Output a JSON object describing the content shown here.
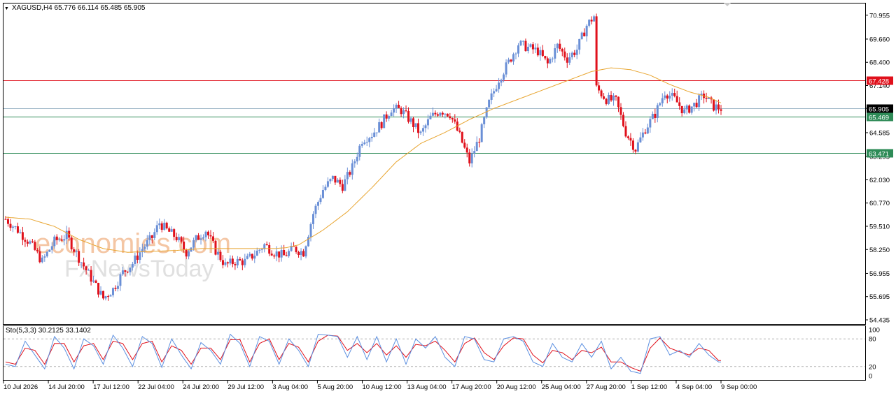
{
  "header": {
    "symbol": "XAGUSD,H4",
    "open": "65.776",
    "high": "66.114",
    "low": "65.485",
    "close": "65.905"
  },
  "watermark": {
    "line1": "economies.com",
    "line2": "FxNewsToday"
  },
  "stochastic": {
    "label": "Sto(5,3,3)",
    "main_value": "30.2125",
    "signal_value": "33.1402",
    "axis_labels": [
      "100",
      "80",
      "20",
      "0"
    ]
  },
  "colors": {
    "bull": "#6A8FD6",
    "bear": "#E0101B",
    "ma": "#E8A530",
    "resistance": "#E0101B",
    "support": "#2E8B57",
    "current": "#9FB8C8",
    "sto_main": "#5B8FE0",
    "sto_signal": "#E0101B"
  },
  "chart_data": {
    "type": "candlestick",
    "title": "",
    "y_ticks": [
      "70.955",
      "69.660",
      "68.400",
      "67.140",
      "65.905",
      "64.585",
      "63.295",
      "62.030",
      "60.770",
      "59.510",
      "58.250",
      "56.955",
      "55.695",
      "54.435"
    ],
    "ylim": [
      54.435,
      71.4
    ],
    "x_tick_labels": [
      "10 Jul 2026",
      "14 Jul 20:00",
      "17 Jul 12:00",
      "22 Jul 04:00",
      "24 Jul 20:00",
      "29 Jul 12:00",
      "3 Aug 04:00",
      "5 Aug 20:00",
      "10 Aug 12:00",
      "13 Aug 04:00",
      "17 Aug 20:00",
      "20 Aug 12:00",
      "25 Aug 04:00",
      "27 Aug 20:00",
      "1 Sep 12:00",
      "4 Sep 04:00",
      "9 Sep 00:00"
    ],
    "horizontal_levels": [
      {
        "value": 67.428,
        "label": "67.428",
        "kind": "resistance"
      },
      {
        "value": 65.905,
        "label": "65.905",
        "kind": "current"
      },
      {
        "value": 65.469,
        "label": "65.469",
        "kind": "support"
      },
      {
        "value": 63.471,
        "label": "63.471",
        "kind": "support"
      }
    ],
    "close_path": [
      [
        0,
        59.9
      ],
      [
        5,
        59.3
      ],
      [
        10,
        58.6
      ],
      [
        15,
        57.6
      ],
      [
        20,
        58.7
      ],
      [
        25,
        59.0
      ],
      [
        30,
        57.8
      ],
      [
        35,
        56.7
      ],
      [
        40,
        55.6
      ],
      [
        44,
        56.1
      ],
      [
        48,
        57.0
      ],
      [
        52,
        57.5
      ],
      [
        56,
        58.3
      ],
      [
        60,
        58.9
      ],
      [
        63,
        59.7
      ],
      [
        66,
        59.3
      ],
      [
        70,
        58.9
      ],
      [
        74,
        58.1
      ],
      [
        78,
        58.8
      ],
      [
        82,
        59.3
      ],
      [
        86,
        58.2
      ],
      [
        90,
        57.4
      ],
      [
        94,
        57.6
      ],
      [
        98,
        57.6
      ],
      [
        102,
        58.0
      ],
      [
        106,
        58.5
      ],
      [
        110,
        58.1
      ],
      [
        114,
        57.9
      ],
      [
        118,
        58.3
      ],
      [
        122,
        58.1
      ],
      [
        126,
        60.2
      ],
      [
        130,
        61.5
      ],
      [
        134,
        62.1
      ],
      [
        138,
        61.7
      ],
      [
        142,
        62.7
      ],
      [
        146,
        64.2
      ],
      [
        150,
        64.5
      ],
      [
        154,
        65.1
      ],
      [
        158,
        65.9
      ],
      [
        162,
        65.8
      ],
      [
        166,
        65.2
      ],
      [
        170,
        64.5
      ],
      [
        174,
        65.4
      ],
      [
        178,
        65.8
      ],
      [
        182,
        65.6
      ],
      [
        186,
        64.4
      ],
      [
        190,
        63.0
      ],
      [
        194,
        64.3
      ],
      [
        198,
        66.2
      ],
      [
        202,
        67.5
      ],
      [
        206,
        68.4
      ],
      [
        210,
        69.4
      ],
      [
        214,
        69.2
      ],
      [
        218,
        69.0
      ],
      [
        222,
        68.3
      ],
      [
        226,
        69.3
      ],
      [
        230,
        68.6
      ],
      [
        234,
        69.1
      ],
      [
        238,
        70.4
      ],
      [
        241,
        70.9
      ],
      [
        242,
        67.0
      ],
      [
        246,
        66.4
      ],
      [
        250,
        66.3
      ],
      [
        254,
        64.6
      ],
      [
        258,
        63.7
      ],
      [
        262,
        64.8
      ],
      [
        266,
        65.6
      ],
      [
        270,
        66.8
      ],
      [
        274,
        66.4
      ],
      [
        278,
        65.7
      ],
      [
        282,
        66.1
      ],
      [
        286,
        66.6
      ],
      [
        290,
        66.0
      ],
      [
        293,
        65.9
      ]
    ],
    "ma_path": [
      [
        0,
        60.0
      ],
      [
        10,
        59.9
      ],
      [
        20,
        59.5
      ],
      [
        30,
        58.8
      ],
      [
        40,
        58.3
      ],
      [
        50,
        58.1
      ],
      [
        60,
        58.15
      ],
      [
        70,
        58.2
      ],
      [
        80,
        58.3
      ],
      [
        90,
        58.3
      ],
      [
        100,
        58.3
      ],
      [
        110,
        58.3
      ],
      [
        115,
        58.35
      ],
      [
        120,
        58.5
      ],
      [
        130,
        59.3
      ],
      [
        140,
        60.3
      ],
      [
        150,
        61.6
      ],
      [
        160,
        63.0
      ],
      [
        170,
        64.0
      ],
      [
        180,
        64.6
      ],
      [
        190,
        65.3
      ],
      [
        200,
        65.9
      ],
      [
        210,
        66.4
      ],
      [
        220,
        66.9
      ],
      [
        230,
        67.4
      ],
      [
        240,
        67.9
      ],
      [
        248,
        68.1
      ],
      [
        256,
        68.0
      ],
      [
        264,
        67.7
      ],
      [
        272,
        67.2
      ],
      [
        280,
        66.8
      ],
      [
        288,
        66.5
      ],
      [
        293,
        66.2
      ]
    ],
    "stochastic_main_path": [
      [
        0,
        25
      ],
      [
        4,
        20
      ],
      [
        8,
        75
      ],
      [
        12,
        45
      ],
      [
        16,
        15
      ],
      [
        20,
        85
      ],
      [
        24,
        60
      ],
      [
        28,
        15
      ],
      [
        32,
        80
      ],
      [
        36,
        65
      ],
      [
        40,
        25
      ],
      [
        44,
        88
      ],
      [
        48,
        60
      ],
      [
        52,
        20
      ],
      [
        56,
        85
      ],
      [
        60,
        70
      ],
      [
        64,
        18
      ],
      [
        68,
        80
      ],
      [
        72,
        45
      ],
      [
        76,
        15
      ],
      [
        80,
        72
      ],
      [
        84,
        55
      ],
      [
        88,
        25
      ],
      [
        92,
        90
      ],
      [
        96,
        70
      ],
      [
        100,
        20
      ],
      [
        104,
        85
      ],
      [
        108,
        75
      ],
      [
        112,
        25
      ],
      [
        116,
        80
      ],
      [
        120,
        55
      ],
      [
        124,
        20
      ],
      [
        128,
        90
      ],
      [
        132,
        88
      ],
      [
        136,
        85
      ],
      [
        140,
        40
      ],
      [
        144,
        85
      ],
      [
        148,
        35
      ],
      [
        152,
        85
      ],
      [
        156,
        30
      ],
      [
        160,
        80
      ],
      [
        164,
        25
      ],
      [
        168,
        80
      ],
      [
        172,
        60
      ],
      [
        176,
        85
      ],
      [
        180,
        40
      ],
      [
        184,
        20
      ],
      [
        188,
        85
      ],
      [
        192,
        80
      ],
      [
        196,
        35
      ],
      [
        200,
        30
      ],
      [
        204,
        80
      ],
      [
        208,
        85
      ],
      [
        212,
        75
      ],
      [
        216,
        30
      ],
      [
        220,
        20
      ],
      [
        224,
        70
      ],
      [
        228,
        40
      ],
      [
        232,
        30
      ],
      [
        236,
        70
      ],
      [
        240,
        40
      ],
      [
        244,
        75
      ],
      [
        248,
        15
      ],
      [
        252,
        40
      ],
      [
        256,
        10
      ],
      [
        260,
        5
      ],
      [
        264,
        80
      ],
      [
        268,
        85
      ],
      [
        272,
        45
      ],
      [
        276,
        55
      ],
      [
        280,
        40
      ],
      [
        284,
        70
      ],
      [
        288,
        45
      ],
      [
        292,
        30
      ]
    ],
    "stochastic_signal_path": [
      [
        0,
        30
      ],
      [
        4,
        25
      ],
      [
        8,
        60
      ],
      [
        12,
        55
      ],
      [
        16,
        25
      ],
      [
        20,
        70
      ],
      [
        24,
        70
      ],
      [
        28,
        30
      ],
      [
        32,
        65
      ],
      [
        36,
        70
      ],
      [
        40,
        35
      ],
      [
        44,
        75
      ],
      [
        48,
        70
      ],
      [
        52,
        35
      ],
      [
        56,
        70
      ],
      [
        60,
        75
      ],
      [
        64,
        30
      ],
      [
        68,
        65
      ],
      [
        72,
        55
      ],
      [
        76,
        25
      ],
      [
        80,
        60
      ],
      [
        84,
        60
      ],
      [
        88,
        35
      ],
      [
        92,
        78
      ],
      [
        96,
        78
      ],
      [
        100,
        30
      ],
      [
        104,
        70
      ],
      [
        108,
        80
      ],
      [
        112,
        35
      ],
      [
        116,
        70
      ],
      [
        120,
        62
      ],
      [
        124,
        30
      ],
      [
        128,
        75
      ],
      [
        132,
        88
      ],
      [
        136,
        86
      ],
      [
        140,
        55
      ],
      [
        144,
        70
      ],
      [
        148,
        50
      ],
      [
        152,
        70
      ],
      [
        156,
        45
      ],
      [
        160,
        65
      ],
      [
        164,
        40
      ],
      [
        168,
        68
      ],
      [
        172,
        65
      ],
      [
        176,
        75
      ],
      [
        180,
        55
      ],
      [
        184,
        30
      ],
      [
        188,
        70
      ],
      [
        192,
        82
      ],
      [
        196,
        50
      ],
      [
        200,
        35
      ],
      [
        204,
        65
      ],
      [
        208,
        82
      ],
      [
        212,
        80
      ],
      [
        216,
        45
      ],
      [
        220,
        28
      ],
      [
        224,
        55
      ],
      [
        228,
        50
      ],
      [
        232,
        35
      ],
      [
        236,
        55
      ],
      [
        240,
        50
      ],
      [
        244,
        62
      ],
      [
        248,
        30
      ],
      [
        252,
        30
      ],
      [
        256,
        18
      ],
      [
        260,
        10
      ],
      [
        264,
        60
      ],
      [
        268,
        82
      ],
      [
        272,
        60
      ],
      [
        276,
        52
      ],
      [
        280,
        45
      ],
      [
        284,
        60
      ],
      [
        288,
        55
      ],
      [
        292,
        33
      ]
    ],
    "sto_levels": [
      80,
      20
    ]
  }
}
